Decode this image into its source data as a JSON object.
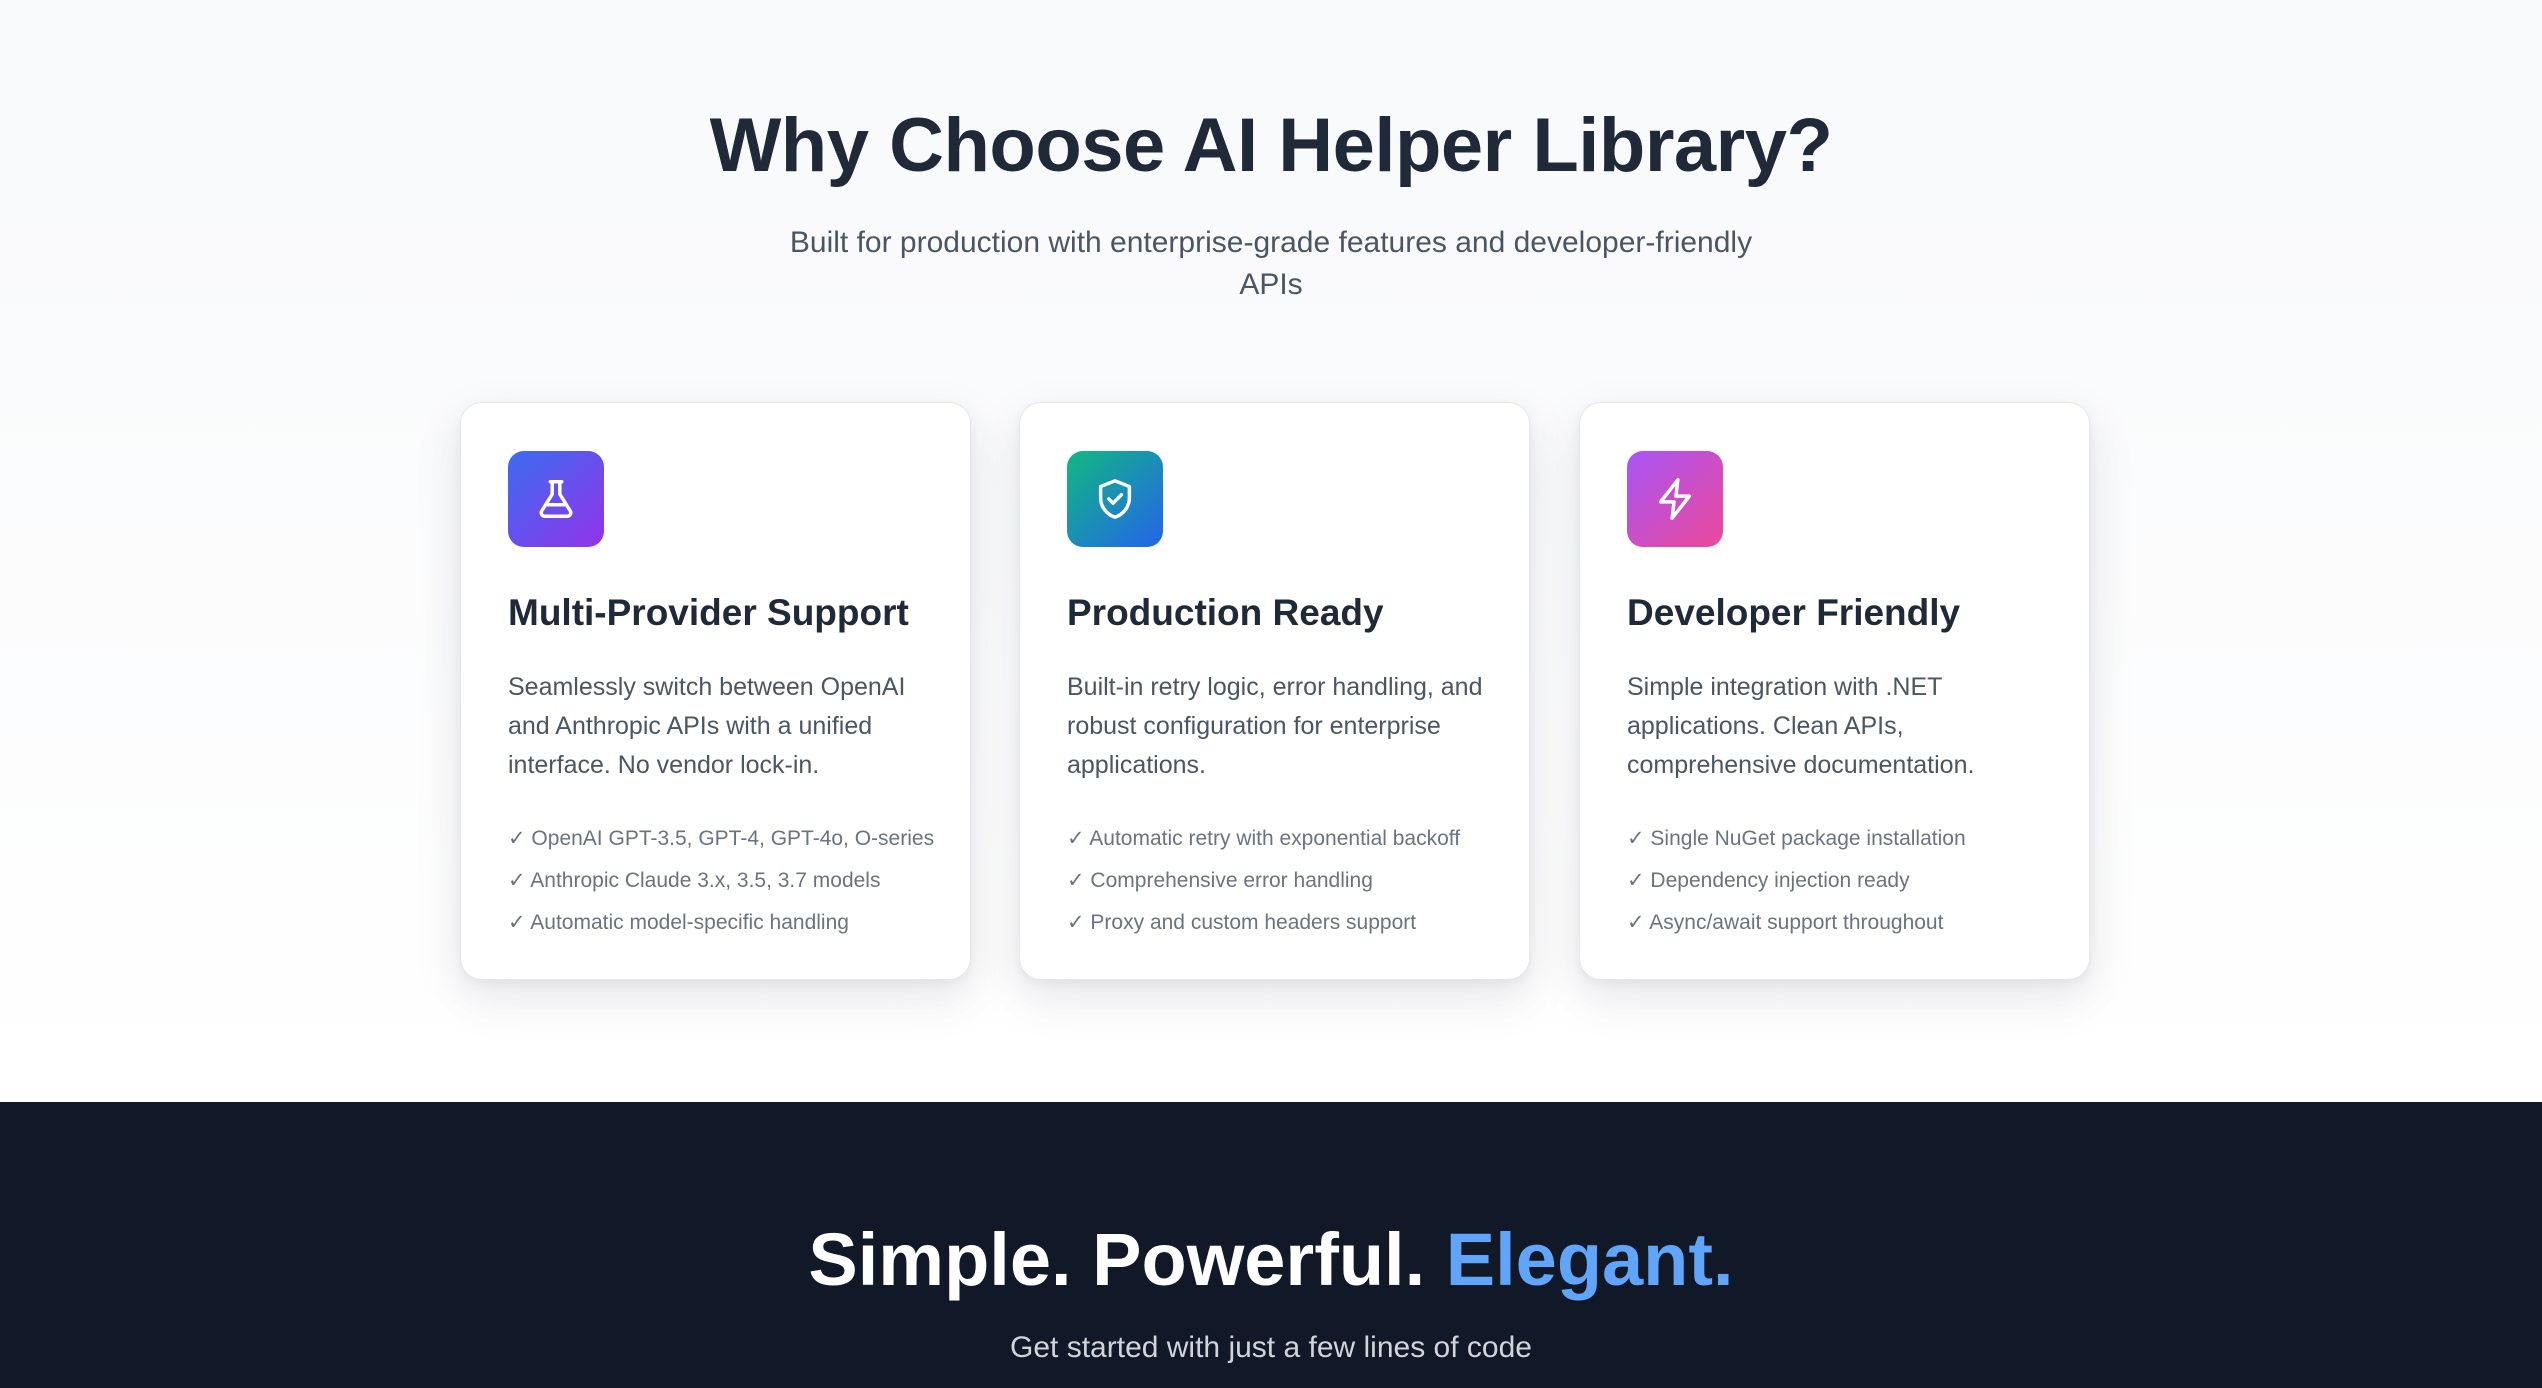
{
  "features": {
    "heading": "Why Choose AI Helper Library?",
    "subheading": "Built for production with enterprise-grade features and developer-friendly APIs",
    "cards": [
      {
        "icon": "flask-icon",
        "title": "Multi-Provider Support",
        "description": "Seamlessly switch between OpenAI and Anthropic APIs with a unified interface. No vendor lock-in.",
        "points": [
          "✓ OpenAI GPT-3.5, GPT-4, GPT-4o, O-series",
          "✓ Anthropic Claude 3.x, 3.5, 3.7 models",
          "✓ Automatic model-specific handling"
        ]
      },
      {
        "icon": "shield-check-icon",
        "title": "Production Ready",
        "description": "Built-in retry logic, error handling, and robust configuration for enterprise applications.",
        "points": [
          "✓ Automatic retry with exponential backoff",
          "✓ Comprehensive error handling",
          "✓ Proxy and custom headers support"
        ]
      },
      {
        "icon": "lightning-bolt-icon",
        "title": "Developer Friendly",
        "description": "Simple integration with .NET applications. Clean APIs, comprehensive documentation.",
        "points": [
          "✓ Single NuGet package installation",
          "✓ Dependency injection ready",
          "✓ Async/await support throughout"
        ]
      }
    ]
  },
  "code_section": {
    "heading_part1": "Simple. Powerful.",
    "heading_accent": "Elegant.",
    "subheading": "Get started with just a few lines of code"
  },
  "colors": {
    "dark_background": "#111827",
    "accent_blue": "#60a5fa",
    "heading_text": "#1f2937"
  }
}
